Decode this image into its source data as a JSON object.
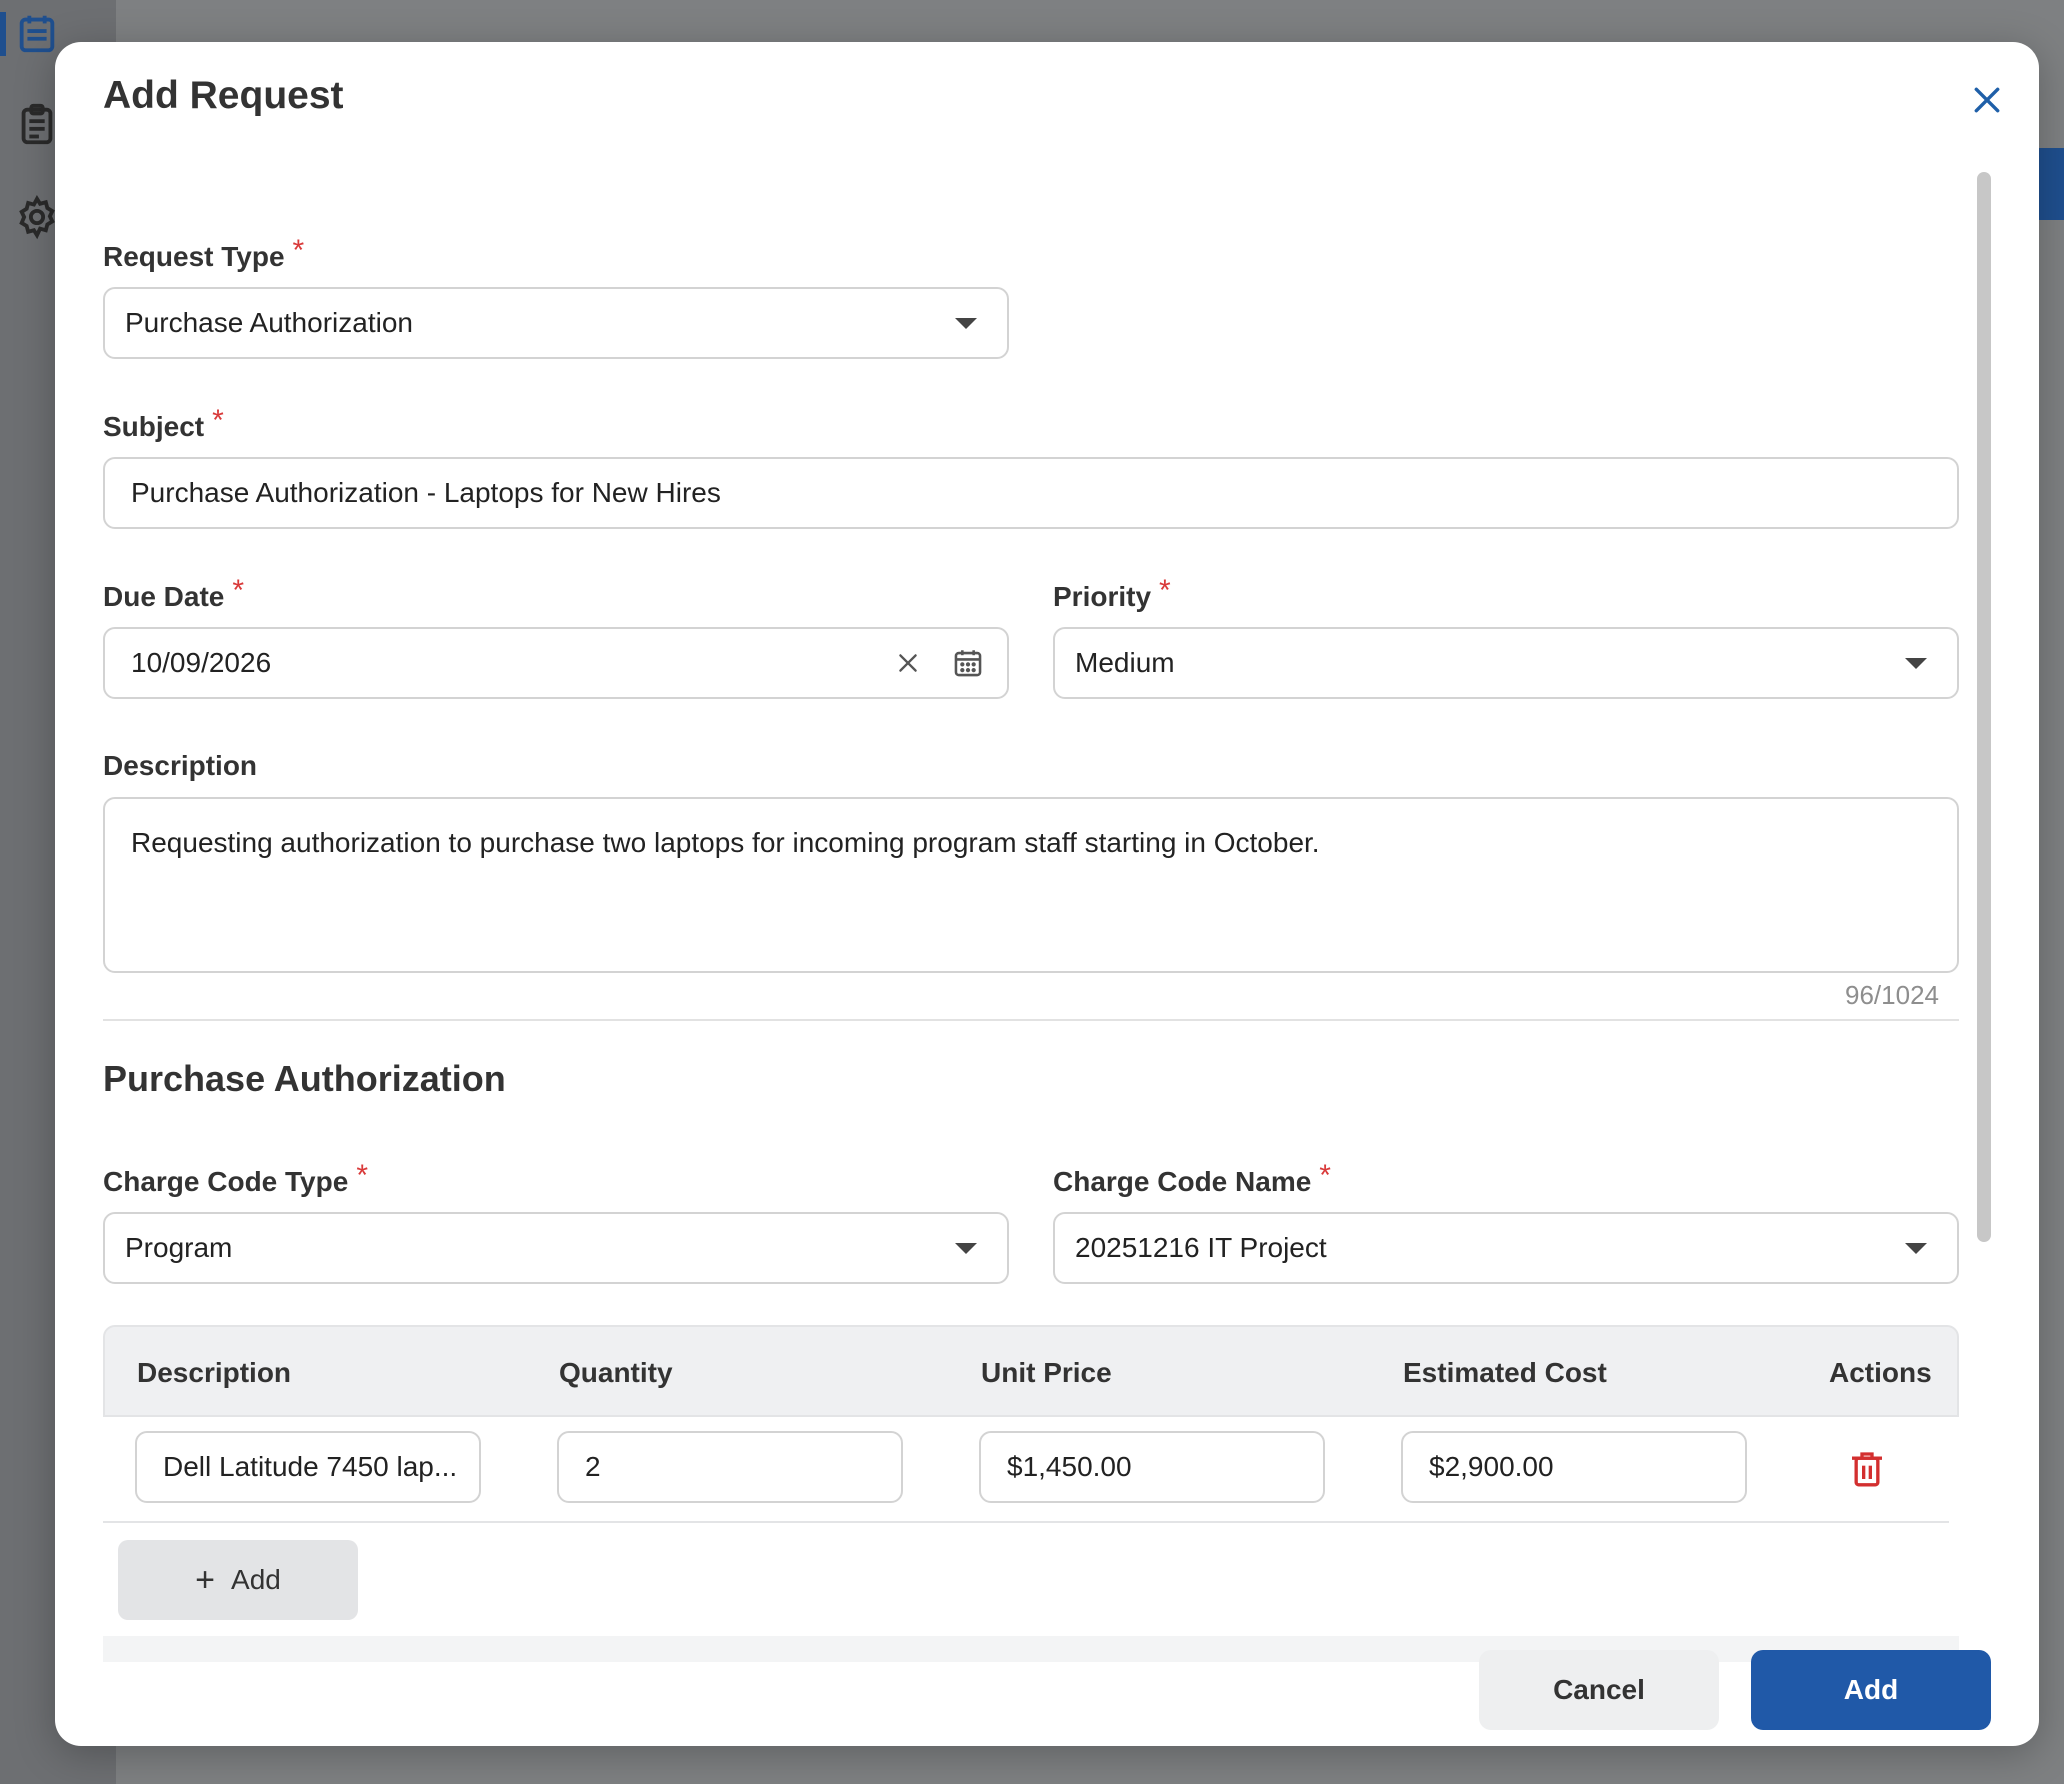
{
  "modal": {
    "title": "Add Request",
    "required_mark": "*"
  },
  "form": {
    "request_type": {
      "label": "Request Type",
      "value": "Purchase Authorization"
    },
    "subject": {
      "label": "Subject",
      "value": "Purchase Authorization - Laptops for New Hires"
    },
    "due_date": {
      "label": "Due Date",
      "value": "10/09/2026"
    },
    "priority": {
      "label": "Priority",
      "value": "Medium"
    },
    "description": {
      "label": "Description",
      "value": "Requesting authorization to purchase two laptops for incoming program staff starting in October.",
      "counter": "96/1024"
    }
  },
  "purchase_section": {
    "title": "Purchase Authorization",
    "charge_code_type": {
      "label": "Charge Code Type",
      "value": "Program"
    },
    "charge_code_name": {
      "label": "Charge Code Name",
      "value": "20251216 IT Project"
    },
    "table": {
      "headers": [
        "Description",
        "Quantity",
        "Unit Price",
        "Estimated Cost",
        "Actions"
      ],
      "rows": [
        {
          "description": "Dell Latitude 7450 lap...",
          "quantity": "2",
          "unit_price": "$1,450.00",
          "estimated_cost": "$2,900.00"
        }
      ],
      "add_label": "Add",
      "add_icon": "plus-icon",
      "delete_icon": "trash-icon"
    }
  },
  "footer": {
    "cancel_label": "Cancel",
    "add_label": "Add"
  },
  "colors": {
    "primary": "#2059a8",
    "required": "#d93a3a",
    "danger": "#d32f2f",
    "close_icon": "#1f5fa8"
  },
  "sidebar_icons": [
    "calendar-icon",
    "clipboard-icon",
    "gear-icon"
  ]
}
